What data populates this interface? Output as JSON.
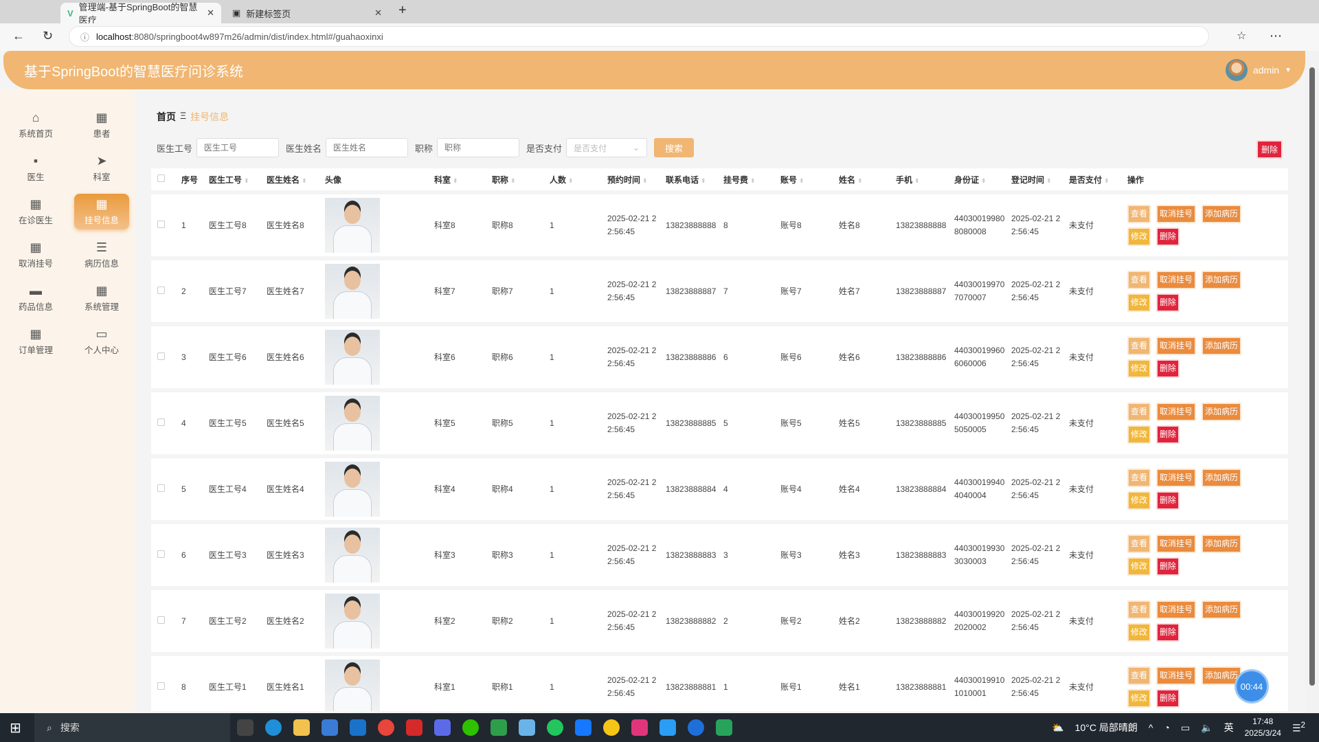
{
  "browser": {
    "tabs": [
      {
        "title": "管理端-基于SpringBoot的智慧医疗"
      },
      {
        "title": "新建标签页"
      }
    ],
    "url_host": "localhost",
    "url_path": ":8080/springboot4w897m26/admin/dist/index.html#/guahaoxinxi"
  },
  "header": {
    "title": "基于SpringBoot的智慧医疗问诊系统",
    "user": "admin"
  },
  "sidebar": {
    "items": [
      {
        "label": "系统首页",
        "icon": "home-icon"
      },
      {
        "label": "患者",
        "icon": "grid-icon"
      },
      {
        "label": "医生",
        "icon": "chat-icon"
      },
      {
        "label": "科室",
        "icon": "send-icon"
      },
      {
        "label": "在诊医生",
        "icon": "grid-icon"
      },
      {
        "label": "挂号信息",
        "icon": "grid-icon",
        "active": true
      },
      {
        "label": "取消挂号",
        "icon": "grid-icon"
      },
      {
        "label": "病历信息",
        "icon": "list-icon"
      },
      {
        "label": "药品信息",
        "icon": "monitor-icon"
      },
      {
        "label": "系统管理",
        "icon": "grid-icon"
      },
      {
        "label": "订单管理",
        "icon": "apps-icon"
      },
      {
        "label": "个人中心",
        "icon": "card-icon"
      }
    ]
  },
  "breadcrumb": {
    "home": "首页",
    "sep": "Ξ",
    "current": "挂号信息"
  },
  "search": {
    "doctor_id_label": "医生工号",
    "doctor_id_placeholder": "医生工号",
    "doctor_name_label": "医生姓名",
    "doctor_name_placeholder": "医生姓名",
    "title_label": "职称",
    "title_placeholder": "职称",
    "paid_label": "是否支付",
    "paid_placeholder": "是否支付",
    "search_button": "搜索",
    "delete_button": "删除"
  },
  "table": {
    "headers": [
      "序号",
      "医生工号",
      "医生姓名",
      "头像",
      "科室",
      "职称",
      "人数",
      "预约时间",
      "联系电话",
      "挂号费",
      "账号",
      "姓名",
      "手机",
      "身份证",
      "登记时间",
      "是否支付",
      "操作"
    ],
    "actions": {
      "view": "查看",
      "cancel": "取消挂号",
      "add": "添加病历",
      "edit": "修改",
      "delete": "删除"
    },
    "rows": [
      {
        "no": "1",
        "doctor_id": "医生工号8",
        "doctor_name": "医生姓名8",
        "dept": "科室8",
        "title": "职称8",
        "count": "1",
        "appt_time": "2025-02-21 22:56:45",
        "phone": "13823888888",
        "fee": "8",
        "account": "账号8",
        "name": "姓名8",
        "mobile": "13823888888",
        "id_card": "440300199808080008",
        "reg_time": "2025-02-21 22:56:45",
        "paid": "未支付"
      },
      {
        "no": "2",
        "doctor_id": "医生工号7",
        "doctor_name": "医生姓名7",
        "dept": "科室7",
        "title": "职称7",
        "count": "1",
        "appt_time": "2025-02-21 22:56:45",
        "phone": "13823888887",
        "fee": "7",
        "account": "账号7",
        "name": "姓名7",
        "mobile": "13823888887",
        "id_card": "440300199707070007",
        "reg_time": "2025-02-21 22:56:45",
        "paid": "未支付"
      },
      {
        "no": "3",
        "doctor_id": "医生工号6",
        "doctor_name": "医生姓名6",
        "dept": "科室6",
        "title": "职称6",
        "count": "1",
        "appt_time": "2025-02-21 22:56:45",
        "phone": "13823888886",
        "fee": "6",
        "account": "账号6",
        "name": "姓名6",
        "mobile": "13823888886",
        "id_card": "440300199606060006",
        "reg_time": "2025-02-21 22:56:45",
        "paid": "未支付"
      },
      {
        "no": "4",
        "doctor_id": "医生工号5",
        "doctor_name": "医生姓名5",
        "dept": "科室5",
        "title": "职称5",
        "count": "1",
        "appt_time": "2025-02-21 22:56:45",
        "phone": "13823888885",
        "fee": "5",
        "account": "账号5",
        "name": "姓名5",
        "mobile": "13823888885",
        "id_card": "440300199505050005",
        "reg_time": "2025-02-21 22:56:45",
        "paid": "未支付"
      },
      {
        "no": "5",
        "doctor_id": "医生工号4",
        "doctor_name": "医生姓名4",
        "dept": "科室4",
        "title": "职称4",
        "count": "1",
        "appt_time": "2025-02-21 22:56:45",
        "phone": "13823888884",
        "fee": "4",
        "account": "账号4",
        "name": "姓名4",
        "mobile": "13823888884",
        "id_card": "440300199404040004",
        "reg_time": "2025-02-21 22:56:45",
        "paid": "未支付"
      },
      {
        "no": "6",
        "doctor_id": "医生工号3",
        "doctor_name": "医生姓名3",
        "dept": "科室3",
        "title": "职称3",
        "count": "1",
        "appt_time": "2025-02-21 22:56:45",
        "phone": "13823888883",
        "fee": "3",
        "account": "账号3",
        "name": "姓名3",
        "mobile": "13823888883",
        "id_card": "440300199303030003",
        "reg_time": "2025-02-21 22:56:45",
        "paid": "未支付"
      },
      {
        "no": "7",
        "doctor_id": "医生工号2",
        "doctor_name": "医生姓名2",
        "dept": "科室2",
        "title": "职称2",
        "count": "1",
        "appt_time": "2025-02-21 22:56:45",
        "phone": "13823888882",
        "fee": "2",
        "account": "账号2",
        "name": "姓名2",
        "mobile": "13823888882",
        "id_card": "440300199202020002",
        "reg_time": "2025-02-21 22:56:45",
        "paid": "未支付"
      },
      {
        "no": "8",
        "doctor_id": "医生工号1",
        "doctor_name": "医生姓名1",
        "dept": "科室1",
        "title": "职称1",
        "count": "1",
        "appt_time": "2025-02-21 22:56:45",
        "phone": "13823888881",
        "fee": "1",
        "account": "账号1",
        "name": "姓名1",
        "mobile": "13823888881",
        "id_card": "440300199101010001",
        "reg_time": "2025-02-21 22:56:45",
        "paid": "未支付"
      }
    ]
  },
  "timer": "00:44",
  "taskbar": {
    "search": "搜索",
    "weather": "10°C 局部晴朗",
    "ime": "英",
    "time": "17:48",
    "date": "2025/3/24",
    "notifications": "2"
  }
}
